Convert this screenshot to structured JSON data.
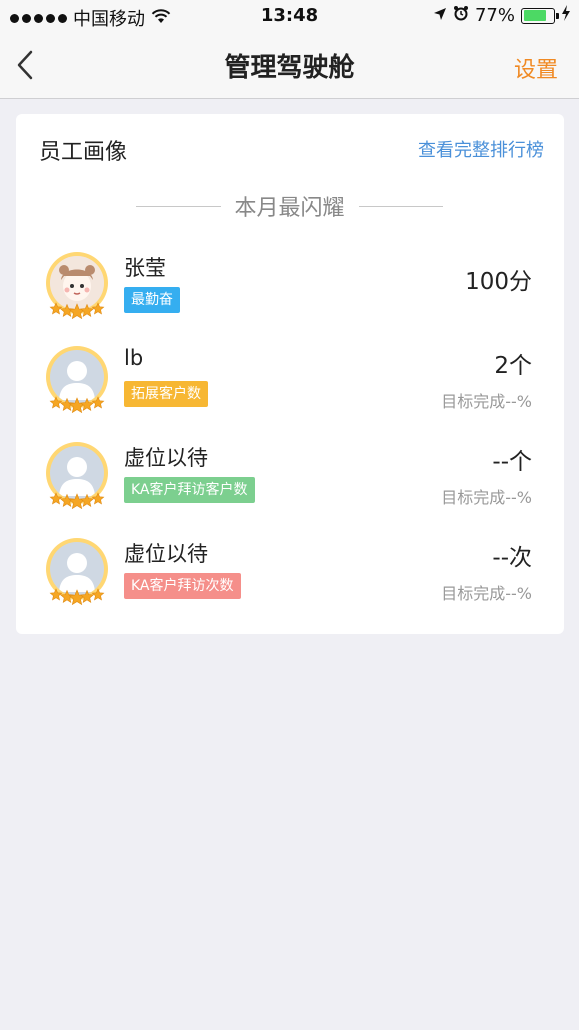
{
  "status_bar": {
    "carrier": "中国移动",
    "time": "13:48",
    "battery_percent": "77%",
    "battery_level": 0.77,
    "icons": [
      "signal-dots",
      "wifi-icon",
      "location-arrow-icon",
      "alarm-icon",
      "battery-icon",
      "charging-icon"
    ]
  },
  "nav": {
    "back_icon": "chevron-left-icon",
    "title": "管理驾驶舱",
    "settings_label": "设置"
  },
  "card": {
    "title": "员工画像",
    "link": "查看完整排行榜",
    "section_label": "本月最闪耀",
    "rows": [
      {
        "name": "张莹",
        "tag": "最勤奋",
        "tag_color": "#35aef0",
        "value": "100分",
        "sub": "",
        "avatar": "photo"
      },
      {
        "name": "lb",
        "tag": "拓展客户数",
        "tag_color": "#f7b733",
        "value": "2个",
        "sub": "目标完成--%",
        "avatar": "placeholder"
      },
      {
        "name": "虚位以待",
        "tag": "KA客户拜访客户数",
        "tag_color": "#7ccf8f",
        "value": "--个",
        "sub": "目标完成--%",
        "avatar": "placeholder"
      },
      {
        "name": "虚位以待",
        "tag": "KA客户拜访次数",
        "tag_color": "#f58f8a",
        "value": "--次",
        "sub": "目标完成--%",
        "avatar": "placeholder"
      }
    ]
  },
  "colors": {
    "accent_orange": "#f08a24",
    "link_blue": "#4a90d9",
    "background": "#efeff4",
    "avatar_ring": "#ffd773",
    "star": "#f5a623"
  }
}
